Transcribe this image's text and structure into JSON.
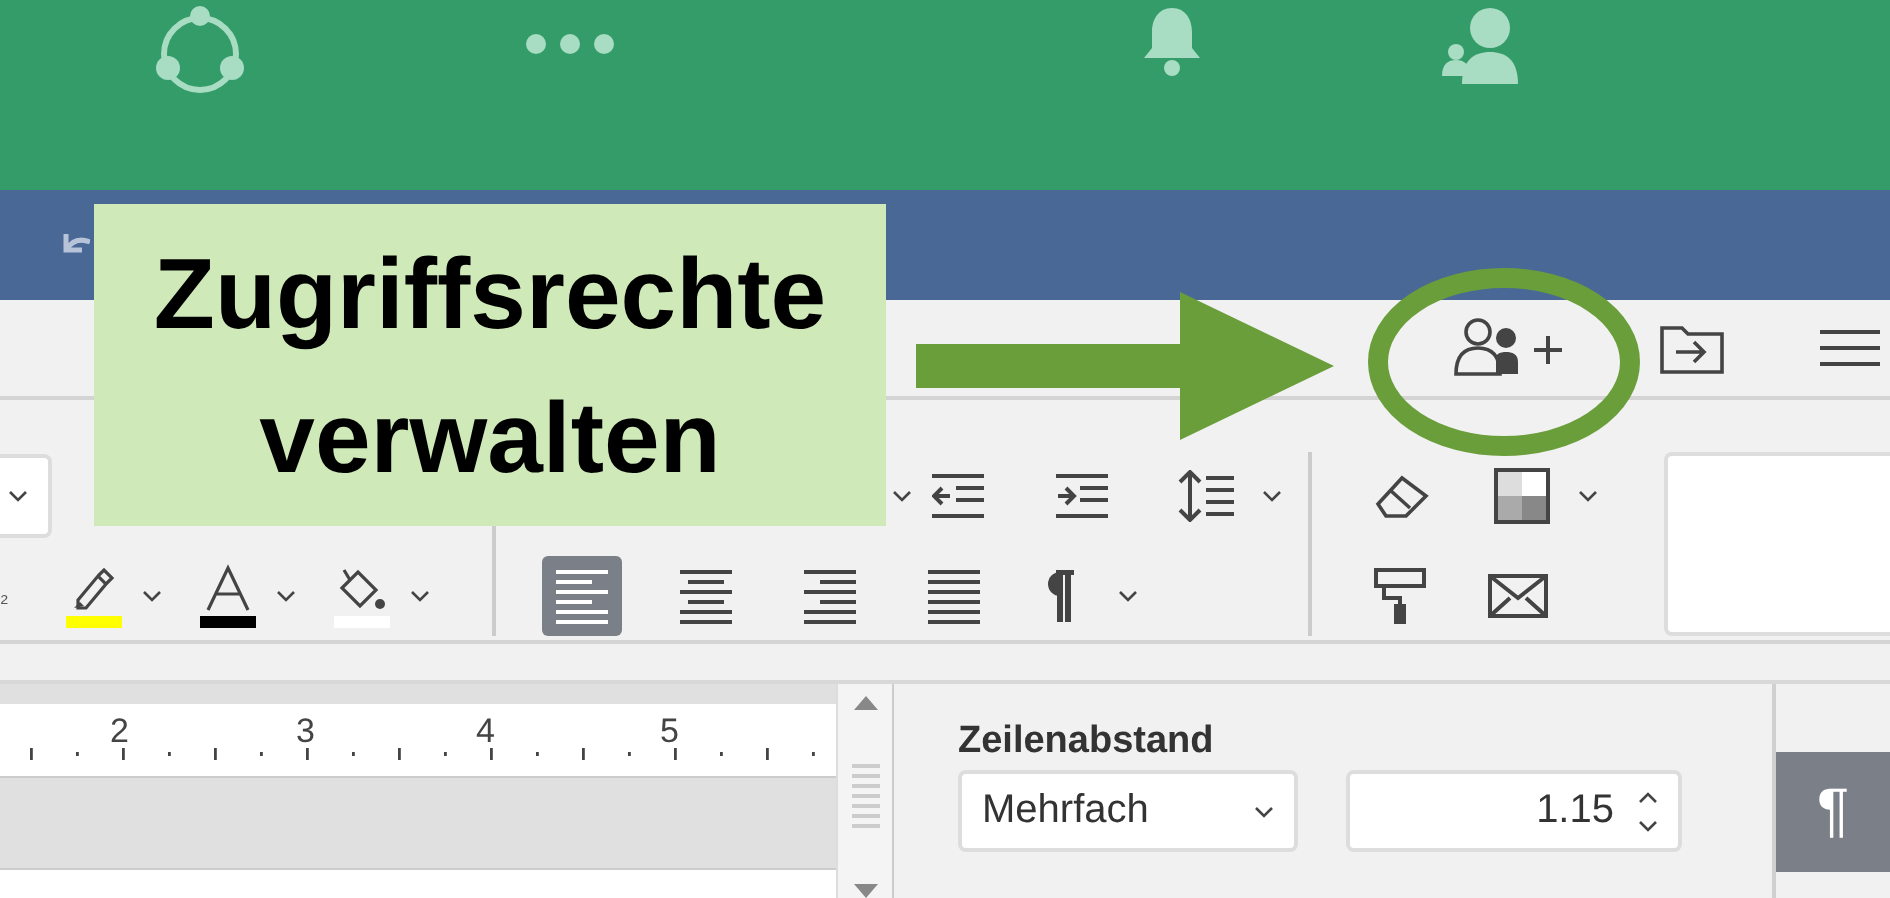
{
  "toolbar": {
    "subscript_fragment": "₂",
    "color_tools": [
      {
        "kind": "highlight",
        "color": "#ffff00"
      },
      {
        "kind": "font_color",
        "color": "#000000"
      },
      {
        "kind": "fill",
        "color": "#ffffff"
      }
    ],
    "alignment": [
      {
        "kind": "left",
        "selected": true
      },
      {
        "kind": "center",
        "selected": false
      },
      {
        "kind": "right",
        "selected": false
      },
      {
        "kind": "justify",
        "selected": false
      }
    ]
  },
  "ruler": {
    "labels": [
      "2",
      "3",
      "4",
      "5"
    ]
  },
  "paragraph_panel": {
    "heading": "Zeilenabstand",
    "spacing_mode": "Mehrfach",
    "spacing_value": "1.15"
  },
  "side_panel": {
    "buttons": [
      {
        "label": "¶",
        "selected": true
      }
    ]
  },
  "callout": {
    "text": "Zugriffsrechte verwalten"
  }
}
